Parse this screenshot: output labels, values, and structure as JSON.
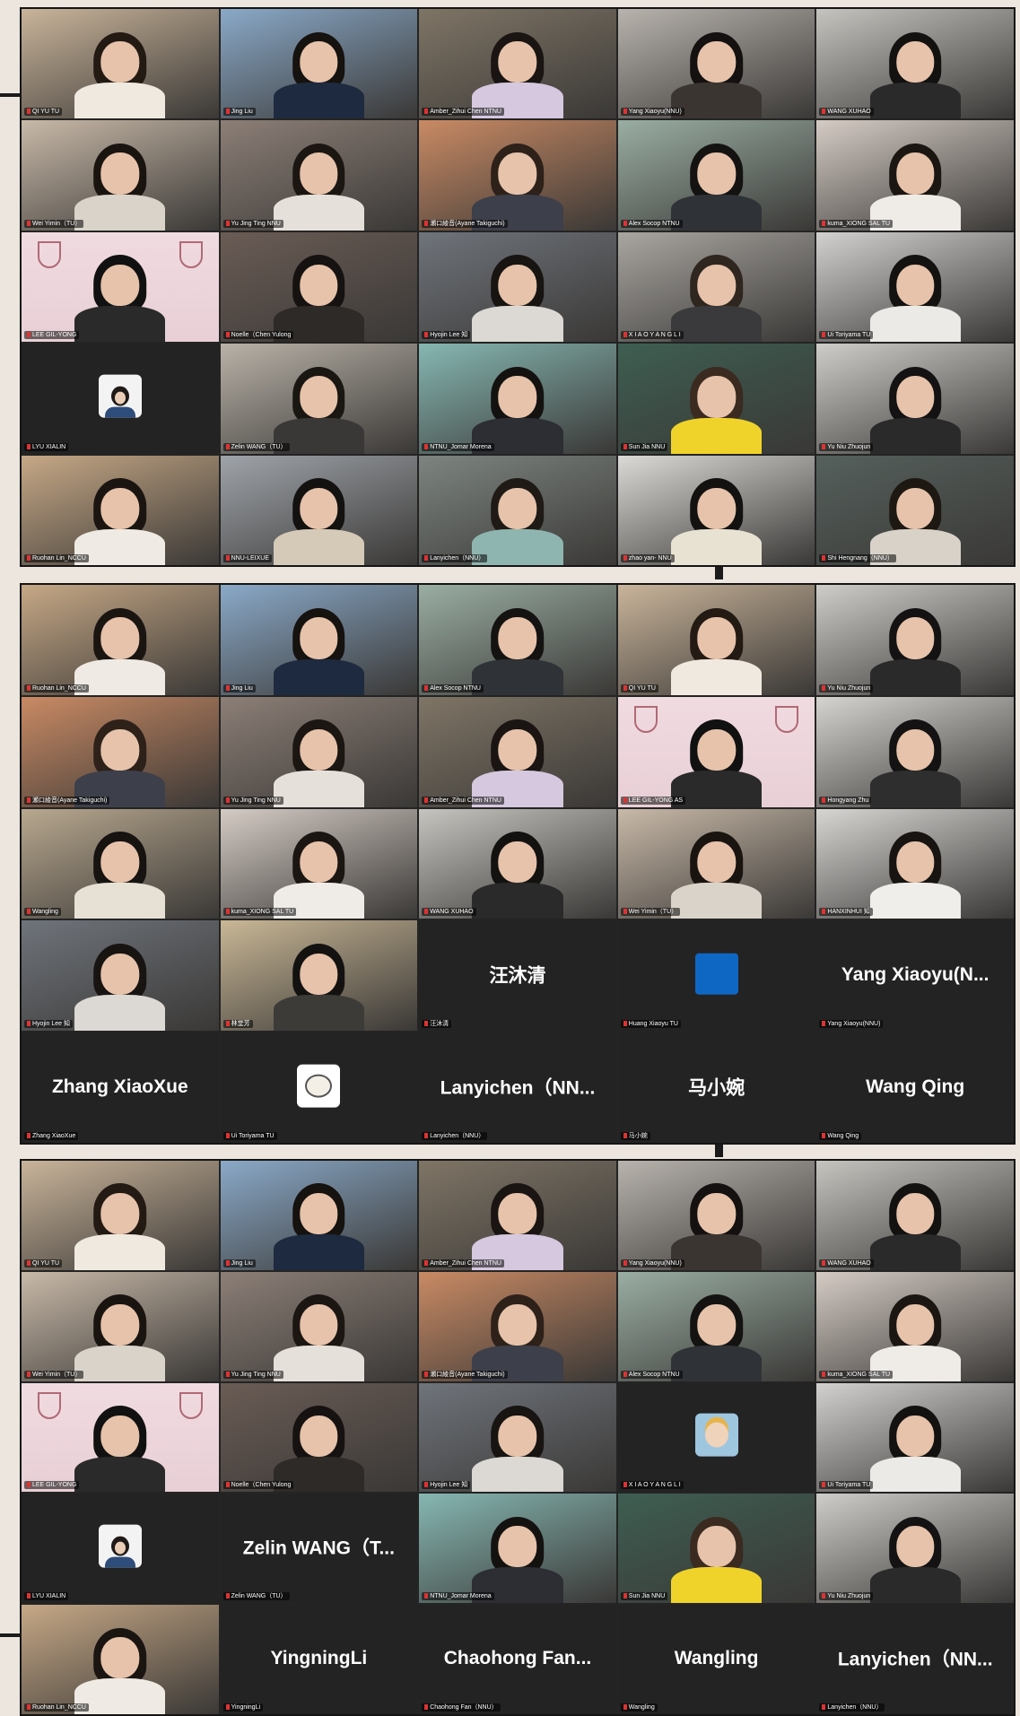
{
  "screens": [
    {
      "tiles": [
        {
          "name": "QI YU TU",
          "kind": "video",
          "bg": "#c9b49a",
          "shirt": "#efe9df",
          "hair": "#241a14",
          "active": false
        },
        {
          "name": "Jing Liu",
          "kind": "video",
          "bg": "#8aa9c8",
          "shirt": "#1e2a3f",
          "hair": "#15120f",
          "active": true
        },
        {
          "name": "Amber_Zihui Chen NTNU",
          "kind": "video",
          "bg": "#7f7566",
          "shirt": "#d5c8df",
          "hair": "#1a1512",
          "active": false
        },
        {
          "name": "Yang Xiaoyu(NNU)",
          "kind": "video",
          "bg": "#b8b3ad",
          "shirt": "#3b3532",
          "hair": "#141110",
          "active": false
        },
        {
          "name": "WANG XUHAO",
          "kind": "video",
          "bg": "#c5c4bf",
          "shirt": "#2b2a2a",
          "hair": "#131211",
          "active": false
        },
        {
          "name": "Wei Yimin（TU）",
          "kind": "video",
          "bg": "#c8b9a8",
          "shirt": "#d9d3ca",
          "hair": "#1a1411",
          "active": false
        },
        {
          "name": "Yu Jing Ting NNU",
          "kind": "video",
          "bg": "#8c7f77",
          "shirt": "#e6e0da",
          "hair": "#1c1613",
          "active": false
        },
        {
          "name": "瀬口綾音(Ayane Takiguchi)",
          "kind": "video",
          "bg": "#c98a64",
          "shirt": "#3d3f4a",
          "hair": "#2d211a",
          "active": false
        },
        {
          "name": "Alex Socop NTNU",
          "kind": "video",
          "bg": "#9aaea3",
          "shirt": "#2f3236",
          "hair": "#141312",
          "active": false
        },
        {
          "name": "kuma_XIONG SAL TU",
          "kind": "video",
          "bg": "#d4cbc4",
          "shirt": "#efece8",
          "hair": "#1c1613",
          "active": false
        },
        {
          "name": "LEE GIL-YONG",
          "kind": "korea",
          "bg": "#eed7dc",
          "shirt": "#2a2a2a",
          "hair": "#111",
          "active": false
        },
        {
          "name": "Noelle（Chen Yulong",
          "kind": "video",
          "bg": "#6a5c55",
          "shirt": "#2e2a28",
          "hair": "#161211",
          "active": false
        },
        {
          "name": "Hyojin Lee 知",
          "kind": "video",
          "bg": "#6f747b",
          "shirt": "#dcd9d4",
          "hair": "#171412",
          "active": false
        },
        {
          "name": "X I A O Y A N G L I",
          "kind": "video",
          "bg": "#a9a6a1",
          "shirt": "#3a3a3c",
          "hair": "#302620",
          "active": false
        },
        {
          "name": "Ui Toriyama TU",
          "kind": "video",
          "bg": "#d2d1cf",
          "shirt": "#ebeae7",
          "hair": "#141211",
          "active": false
        },
        {
          "name": "LYU XIALIN",
          "kind": "avatar",
          "active": false
        },
        {
          "name": "Zelin WANG（TU）",
          "kind": "video",
          "bg": "#b9b2a8",
          "shirt": "#3a3836",
          "hair": "#1a1612",
          "active": false
        },
        {
          "name": "NTNU_Jomar Morena",
          "kind": "video",
          "bg": "#86b7b2",
          "shirt": "#2c2e33",
          "hair": "#141210",
          "active": false
        },
        {
          "name": "Sun Jia NNU",
          "kind": "video",
          "bg": "#3e5e52",
          "shirt": "#f0d32a",
          "hair": "#3a2a20",
          "active": false
        },
        {
          "name": "Yu Niu Zhuojun",
          "kind": "video",
          "bg": "#cfcdc9",
          "shirt": "#2a2a2a",
          "hair": "#141212",
          "active": false
        },
        {
          "name": "Ruohan Lin_NCCU",
          "kind": "video",
          "bg": "#c6a886",
          "shirt": "#efeae3",
          "hair": "#1b1512",
          "active": false
        },
        {
          "name": "NNU-LEIXUE",
          "kind": "video",
          "bg": "#9fa4aa",
          "shirt": "#d5c9b8",
          "hair": "#141211",
          "active": false
        },
        {
          "name": "Lanyichen（NNU）",
          "kind": "video",
          "bg": "#7d8580",
          "shirt": "#8fb5b0",
          "hair": "#1f1a16",
          "active": false
        },
        {
          "name": "zhao yan- NNU",
          "kind": "video",
          "bg": "#dcdad6",
          "shirt": "#e8e2d3",
          "hair": "#141211",
          "active": false
        },
        {
          "name": "Shi Hengnang（NNU）",
          "kind": "video",
          "bg": "#55605c",
          "shirt": "#d8d2c8",
          "hair": "#1e1813",
          "active": false
        }
      ]
    },
    {
      "tiles": [
        {
          "name": "Ruohan Lin_NCCU",
          "kind": "video",
          "bg": "#c6a886",
          "shirt": "#efeae3",
          "hair": "#1b1512",
          "active": false
        },
        {
          "name": "Jing Liu",
          "kind": "video",
          "bg": "#8aa9c8",
          "shirt": "#1e2a3f",
          "hair": "#15120f",
          "active": false
        },
        {
          "name": "Alex Socop NTNU",
          "kind": "video",
          "bg": "#9aaea3",
          "shirt": "#2f3236",
          "hair": "#141312",
          "active": false
        },
        {
          "name": "QI YU TU",
          "kind": "video",
          "bg": "#c9b49a",
          "shirt": "#efe9df",
          "hair": "#241a14",
          "active": false
        },
        {
          "name": "Yu Niu Zhuojun",
          "kind": "video",
          "bg": "#cfcdc9",
          "shirt": "#2a2a2a",
          "hair": "#141212",
          "active": false
        },
        {
          "name": "瀬口綾音(Ayane Takiguchi)",
          "kind": "video",
          "bg": "#c98a64",
          "shirt": "#3d3f4a",
          "hair": "#2d211a",
          "active": false
        },
        {
          "name": "Yu Jing Ting NNU",
          "kind": "video",
          "bg": "#8c7f77",
          "shirt": "#e6e0da",
          "hair": "#1c1613",
          "active": false
        },
        {
          "name": "Amber_Zihui Chen NTNU",
          "kind": "video",
          "bg": "#7f7566",
          "shirt": "#d5c8df",
          "hair": "#1a1512",
          "active": false
        },
        {
          "name": "LEE GIL-YONG AS",
          "kind": "korea",
          "bg": "#eed7dc",
          "shirt": "#2a2a2a",
          "hair": "#111",
          "active": false
        },
        {
          "name": "Hongyang Zhu",
          "kind": "video",
          "bg": "#d6d4d0",
          "shirt": "#2e2e2e",
          "hair": "#141212",
          "active": false
        },
        {
          "name": "Wangling",
          "kind": "video",
          "bg": "#b8a88f",
          "shirt": "#e6e1d4",
          "hair": "#161311",
          "active": false
        },
        {
          "name": "kuma_XIONG SAL TU",
          "kind": "video",
          "bg": "#d4cbc4",
          "shirt": "#efece8",
          "hair": "#1c1613",
          "active": false
        },
        {
          "name": "WANG XUHAO",
          "kind": "video",
          "bg": "#c5c4bf",
          "shirt": "#2b2a2a",
          "hair": "#131211",
          "active": false
        },
        {
          "name": "Wei Yimin（TU）",
          "kind": "video",
          "bg": "#c8b9a8",
          "shirt": "#d9d3ca",
          "hair": "#1a1411",
          "active": false
        },
        {
          "name": "HANXINHUI 知",
          "kind": "video",
          "bg": "#d8d6d3",
          "shirt": "#f0eeea",
          "hair": "#171412",
          "active": false
        },
        {
          "name": "Hyojin Lee 知",
          "kind": "video",
          "bg": "#6f747b",
          "shirt": "#dcd9d4",
          "hair": "#171412",
          "active": false
        },
        {
          "name": "林堂芳",
          "kind": "video",
          "bg": "#c9b796",
          "shirt": "#3d3b38",
          "hair": "#141211",
          "active": true
        },
        {
          "name": "汪沐清",
          "kind": "label",
          "label": "汪沐清",
          "active": false
        },
        {
          "name": "Huang Xiaoyu TU",
          "kind": "blue",
          "active": false
        },
        {
          "name": "Yang Xiaoyu(NNU)",
          "kind": "label",
          "label": "Yang Xiaoyu(N...",
          "active": false
        },
        {
          "name": "Zhang XiaoXue",
          "kind": "label",
          "label": "Zhang XiaoXue",
          "active": false
        },
        {
          "name": "Ui Toriyama TU",
          "kind": "sticker",
          "active": false
        },
        {
          "name": "Lanyichen（NNU）",
          "kind": "label",
          "label": "Lanyichen（NN...",
          "active": false
        },
        {
          "name": "马小婉",
          "kind": "label",
          "label": "马小婉",
          "active": false
        },
        {
          "name": "Wang Qing",
          "kind": "label",
          "label": "Wang Qing",
          "active": false
        }
      ]
    },
    {
      "tiles": [
        {
          "name": "QI YU TU",
          "kind": "video",
          "bg": "#c9b49a",
          "shirt": "#efe9df",
          "hair": "#241a14",
          "active": false
        },
        {
          "name": "Jing Liu",
          "kind": "video",
          "bg": "#8aa9c8",
          "shirt": "#1e2a3f",
          "hair": "#15120f",
          "active": false
        },
        {
          "name": "Amber_Zihui Chen NTNU",
          "kind": "video",
          "bg": "#7f7566",
          "shirt": "#d5c8df",
          "hair": "#1a1512",
          "active": false
        },
        {
          "name": "Yang Xiaoyu(NNU)",
          "kind": "video",
          "bg": "#b8b3ad",
          "shirt": "#3b3532",
          "hair": "#141110",
          "active": false
        },
        {
          "name": "WANG XUHAO",
          "kind": "video",
          "bg": "#c5c4bf",
          "shirt": "#2b2a2a",
          "hair": "#131211",
          "active": false
        },
        {
          "name": "Wei Yimin（TU）",
          "kind": "video",
          "bg": "#c8b9a8",
          "shirt": "#d9d3ca",
          "hair": "#1a1411",
          "active": false
        },
        {
          "name": "Yu Jing Ting NNU",
          "kind": "video",
          "bg": "#8c7f77",
          "shirt": "#e6e0da",
          "hair": "#1c1613",
          "active": false
        },
        {
          "name": "瀬口綾音(Ayane Takiguchi)",
          "kind": "video",
          "bg": "#c98a64",
          "shirt": "#3d3f4a",
          "hair": "#2d211a",
          "active": false
        },
        {
          "name": "Alex Socop NTNU",
          "kind": "video",
          "bg": "#9aaea3",
          "shirt": "#2f3236",
          "hair": "#141312",
          "active": false
        },
        {
          "name": "kuma_XIONG SAL TU",
          "kind": "video",
          "bg": "#d4cbc4",
          "shirt": "#efece8",
          "hair": "#1c1613",
          "active": false
        },
        {
          "name": "LEE GIL-YONG",
          "kind": "korea",
          "bg": "#eed7dc",
          "shirt": "#2a2a2a",
          "hair": "#111",
          "active": false
        },
        {
          "name": "Noelle（Chen Yulong",
          "kind": "video",
          "bg": "#6a5c55",
          "shirt": "#2e2a28",
          "hair": "#161211",
          "active": false
        },
        {
          "name": "Hyojin Lee 知",
          "kind": "video",
          "bg": "#6f747b",
          "shirt": "#dcd9d4",
          "hair": "#171412",
          "active": false
        },
        {
          "name": "X I A O Y A N G L I",
          "kind": "baby",
          "active": false
        },
        {
          "name": "Ui Toriyama TU",
          "kind": "video",
          "bg": "#d2d1cf",
          "shirt": "#ebeae7",
          "hair": "#141211",
          "active": false
        },
        {
          "name": "LYU XIALIN",
          "kind": "avatar",
          "active": false
        },
        {
          "name": "Zelin WANG（TU）",
          "kind": "label",
          "label": "Zelin WANG（T...",
          "active": false
        },
        {
          "name": "NTNU_Jomar Morena",
          "kind": "video",
          "bg": "#86b7b2",
          "shirt": "#2c2e33",
          "hair": "#141210",
          "active": true
        },
        {
          "name": "Sun Jia NNU",
          "kind": "video",
          "bg": "#3e5e52",
          "shirt": "#f0d32a",
          "hair": "#3a2a20",
          "active": false
        },
        {
          "name": "Yu Niu Zhuojun",
          "kind": "video",
          "bg": "#cfcdc9",
          "shirt": "#2a2a2a",
          "hair": "#141212",
          "active": false
        },
        {
          "name": "Ruohan Lin_NCCU",
          "kind": "video",
          "bg": "#c6a886",
          "shirt": "#efeae3",
          "hair": "#1b1512",
          "active": false
        },
        {
          "name": "YingningLi",
          "kind": "label",
          "label": "YingningLi",
          "active": false
        },
        {
          "name": "Chaohong Fan（NNU）",
          "kind": "label",
          "label": "Chaohong Fan...",
          "active": false
        },
        {
          "name": "Wangling",
          "kind": "label",
          "label": "Wangling",
          "active": false
        },
        {
          "name": "Lanyichen（NNU）",
          "kind": "label",
          "label": "Lanyichen（NN...",
          "active": false
        }
      ]
    }
  ]
}
